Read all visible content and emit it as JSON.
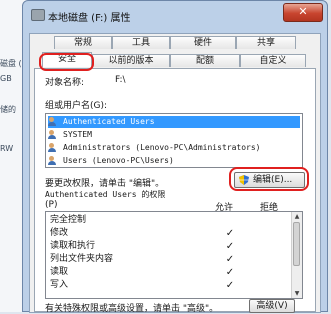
{
  "background": {
    "items": [
      "磁盘 (",
      "GB",
      "储的",
      "RW"
    ]
  },
  "window": {
    "title": "本地磁盘 (F:) 属性",
    "close_label": "✕"
  },
  "tabs_row1": [
    "常规",
    "工具",
    "硬件",
    "共享"
  ],
  "tabs_row2": [
    "安全",
    "以前的版本",
    "配额",
    "自定义"
  ],
  "active_tab": "安全",
  "object_name_label": "对象名称:",
  "object_name_value": "F:\\",
  "groups_label": "组或用户名(G):",
  "users": [
    "Authenticated Users",
    "SYSTEM",
    "Administrators (Lenovo-PC\\Administrators)",
    "Users (Lenovo-PC\\Users)"
  ],
  "selected_user_index": 0,
  "edit_hint": "要更改权限，请单击 \"编辑\"。",
  "edit_button_label": "编辑(E)...",
  "permissions_header": "Authenticated Users 的权限",
  "permissions_subheader": "(P)",
  "col_allow": "允许",
  "col_deny": "拒绝",
  "permissions": [
    {
      "name": "完全控制",
      "allow": ""
    },
    {
      "name": "修改",
      "allow": "✓"
    },
    {
      "name": "读取和执行",
      "allow": "✓"
    },
    {
      "name": "列出文件夹内容",
      "allow": "✓"
    },
    {
      "name": "读取",
      "allow": "✓"
    },
    {
      "name": "写入",
      "allow": "✓"
    }
  ],
  "advanced_hint": "有关特殊权限或高级设置，请单击 \"高级\"。",
  "advanced_button_label": "高级(V)",
  "colors": {
    "highlight": "#e0201f",
    "selection": "#3399ff"
  }
}
